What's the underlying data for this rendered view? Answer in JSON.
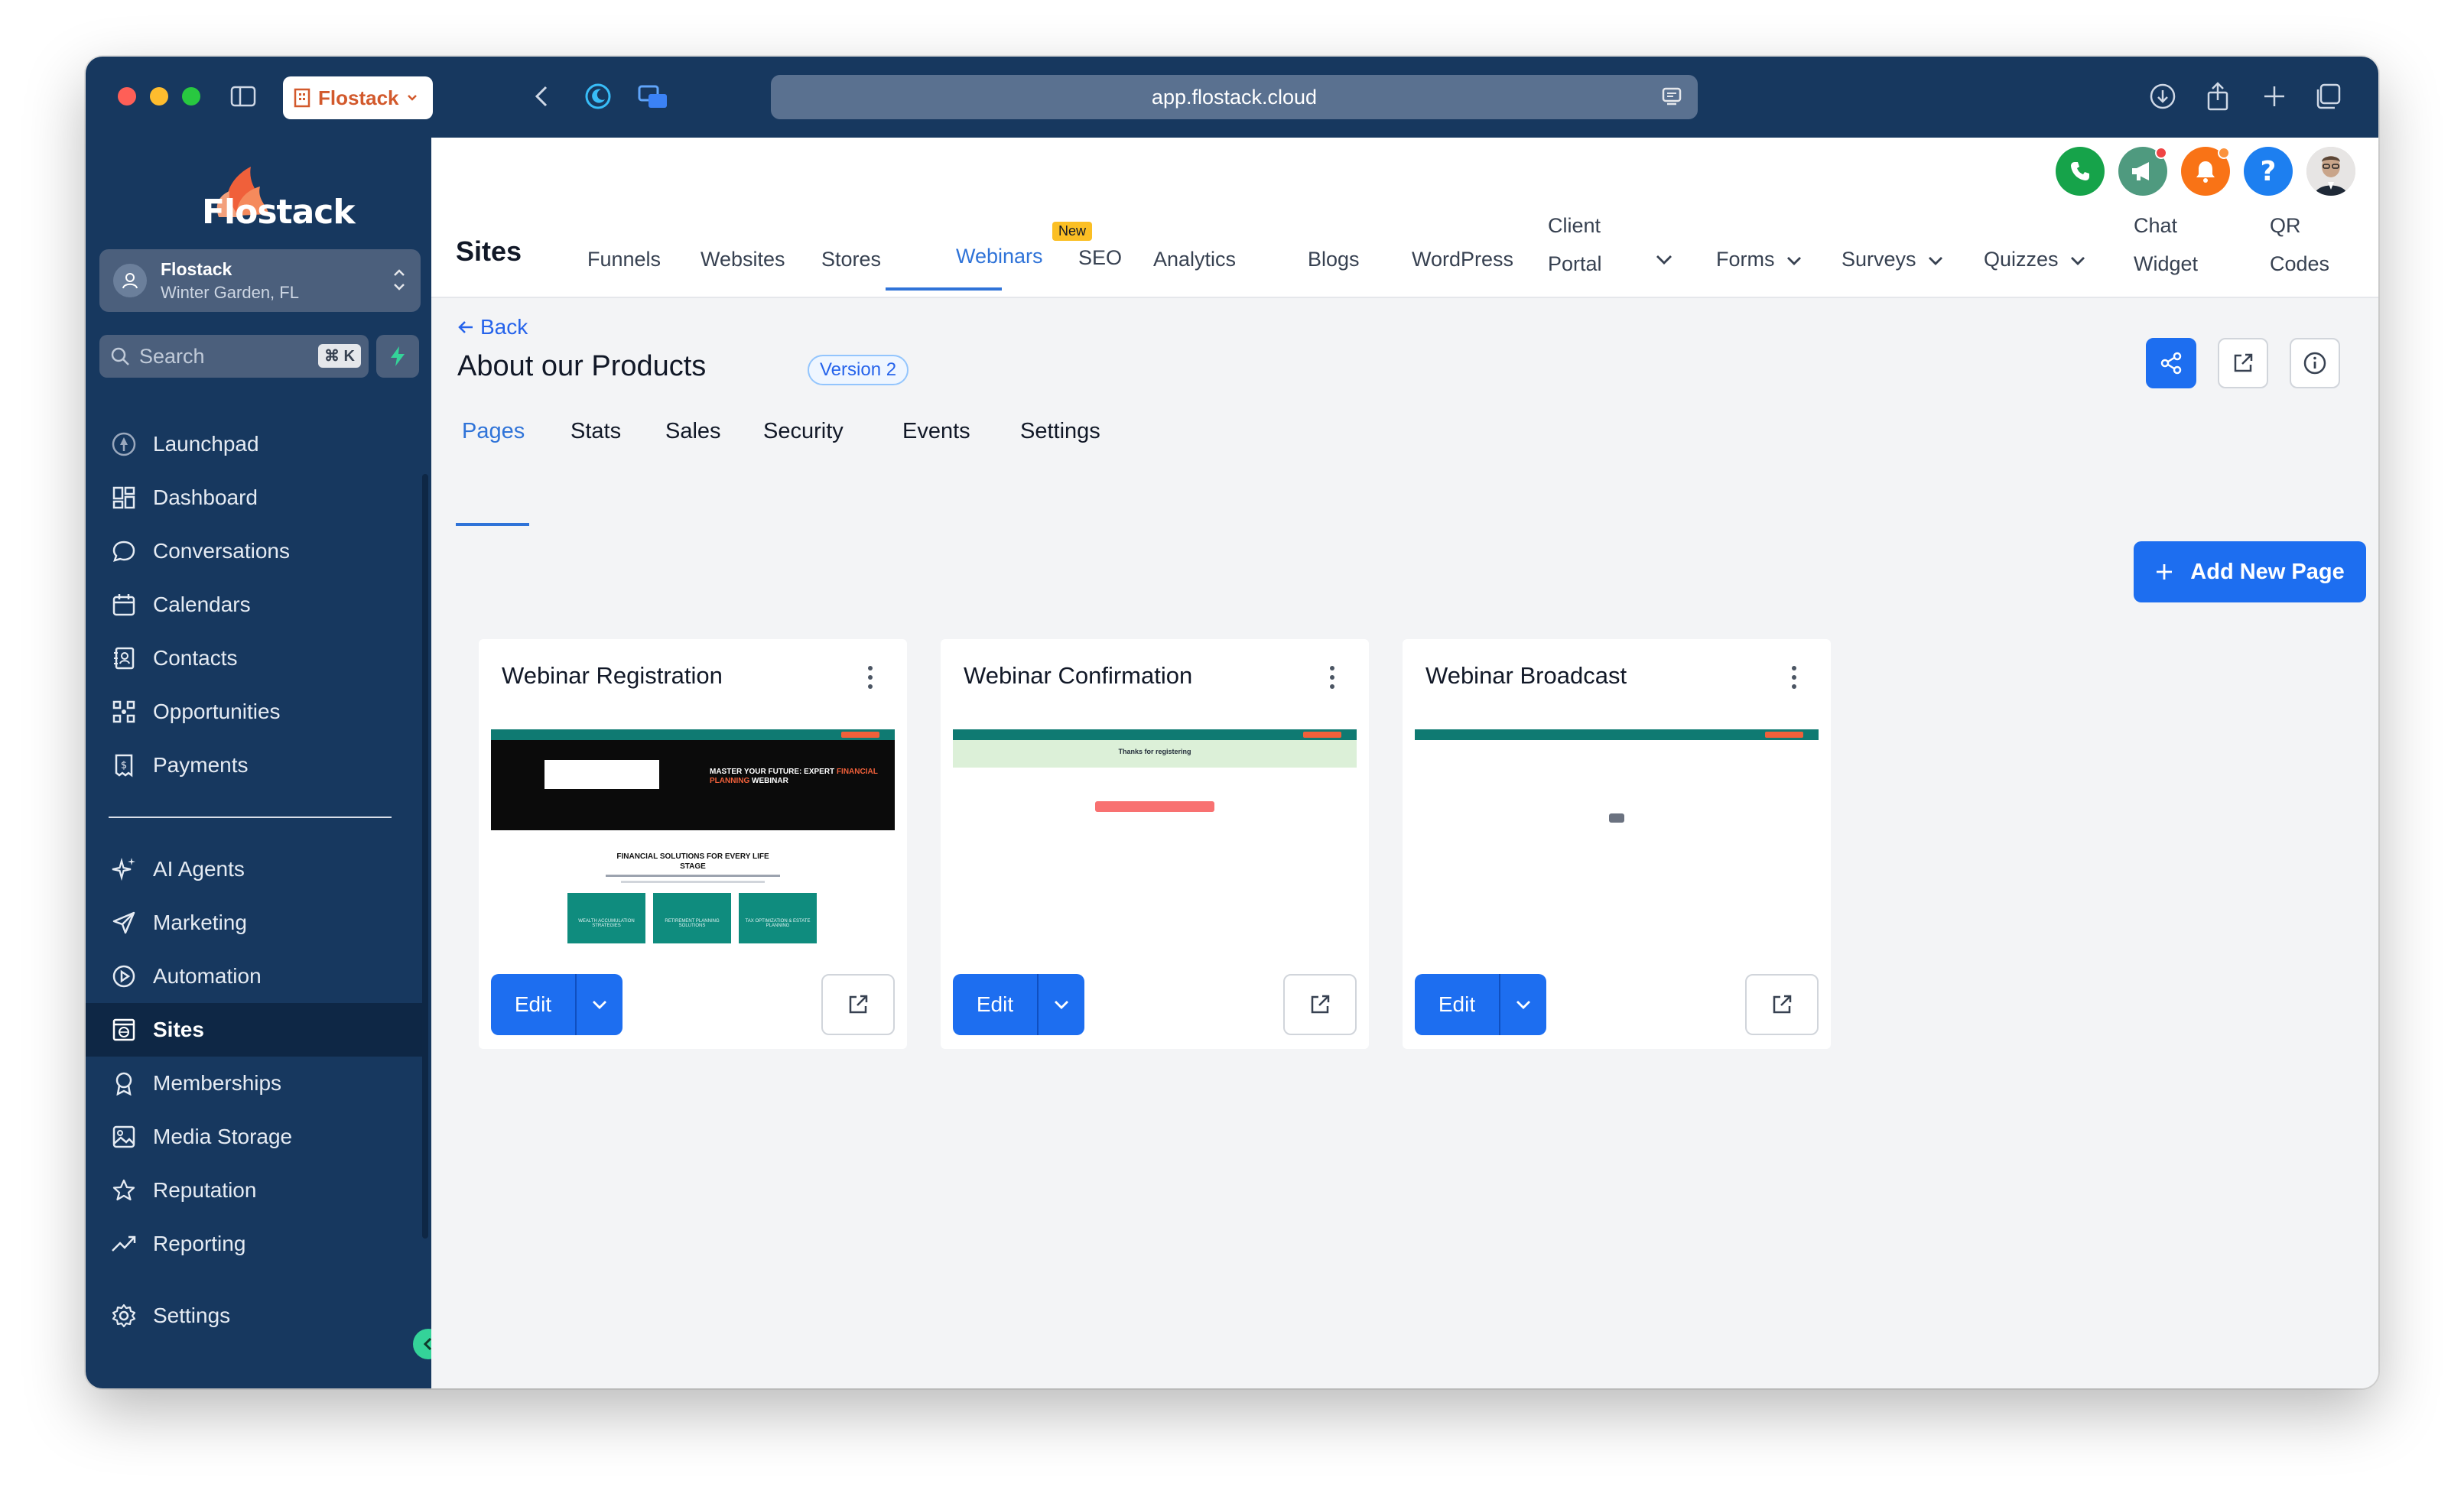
{
  "browser": {
    "tab_label": "Flostack",
    "url": "app.flostack.cloud"
  },
  "sidebar": {
    "logo_text": "Flostack",
    "account": {
      "name": "Flostack",
      "location": "Winter Garden, FL"
    },
    "search": {
      "placeholder": "Search",
      "shortcut": "⌘ K"
    },
    "items": [
      {
        "label": "Launchpad",
        "icon": "launchpad-icon"
      },
      {
        "label": "Dashboard",
        "icon": "dashboard-icon"
      },
      {
        "label": "Conversations",
        "icon": "chat-bubble-icon"
      },
      {
        "label": "Calendars",
        "icon": "calendar-icon"
      },
      {
        "label": "Contacts",
        "icon": "contacts-icon"
      },
      {
        "label": "Opportunities",
        "icon": "opportunities-icon"
      },
      {
        "label": "Payments",
        "icon": "payments-icon"
      },
      {
        "label": "AI Agents",
        "icon": "sparkles-icon"
      },
      {
        "label": "Marketing",
        "icon": "paper-plane-icon"
      },
      {
        "label": "Automation",
        "icon": "automation-icon"
      },
      {
        "label": "Sites",
        "icon": "globe-icon",
        "active": true
      },
      {
        "label": "Memberships",
        "icon": "award-icon"
      },
      {
        "label": "Media Storage",
        "icon": "image-icon"
      },
      {
        "label": "Reputation",
        "icon": "star-icon"
      },
      {
        "label": "Reporting",
        "icon": "trend-icon"
      }
    ],
    "settings_label": "Settings"
  },
  "topnav": {
    "title": "Sites",
    "items": [
      "Funnels",
      "Websites",
      "Stores",
      "Webinars",
      "SEO",
      "Analytics",
      "Blogs",
      "WordPress"
    ],
    "client_portal": [
      "Client",
      "Portal"
    ],
    "dropdowns": [
      "Forms",
      "Surveys",
      "Quizzes"
    ],
    "chat_widget": [
      "Chat",
      "Widget"
    ],
    "qr_codes": [
      "QR",
      "Codes"
    ],
    "active": "Webinars",
    "new_badge": "New"
  },
  "page": {
    "back_label": "Back",
    "title": "About our Products",
    "version": "Version 2",
    "tabs": [
      "Pages",
      "Stats",
      "Sales",
      "Security",
      "Events",
      "Settings"
    ],
    "active_tab": "Pages",
    "add_button": "Add New Page"
  },
  "cards": [
    {
      "title": "Webinar Registration",
      "edit_label": "Edit"
    },
    {
      "title": "Webinar Confirmation",
      "edit_label": "Edit"
    },
    {
      "title": "Webinar Broadcast",
      "edit_label": "Edit"
    }
  ],
  "thumb_text": {
    "reg_headline_white": "MASTER YOUR FUTURE: EXPERT ",
    "reg_headline_red": "FINANCIAL PLANNING",
    "reg_headline_end": " WEBINAR",
    "reg_section": "FINANCIAL SOLUTIONS FOR EVERY LIFE STAGE",
    "reg_tiles": [
      "WEALTH ACCUMULATION STRATEGIES",
      "RETIREMENT PLANNING SOLUTIONS",
      "TAX OPTIMIZATION & ESTATE PLANNING"
    ],
    "conf_message": "Thanks for registering"
  },
  "colors": {
    "sidebar_bg": "#17385f",
    "accent": "#1d6ef0",
    "brand_orange": "#f0603a",
    "thumb_teal": "#0f7a72"
  }
}
